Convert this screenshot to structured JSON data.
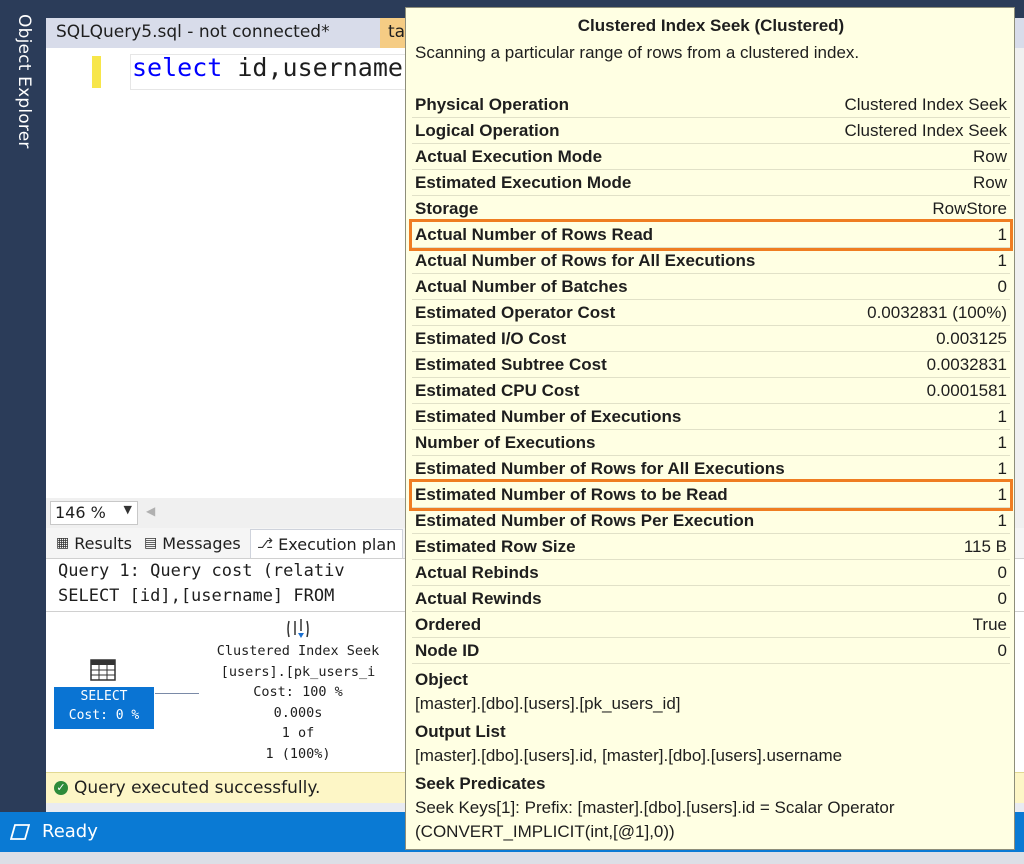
{
  "sidebar": {
    "object_explorer_label": "Object Explorer"
  },
  "tabs": {
    "active_tab": "SQLQuery5.sql - not connected*",
    "second_tab": "tal"
  },
  "editor": {
    "keyword": "select",
    "code_rest": " id,username"
  },
  "zoom": {
    "value": "146 %"
  },
  "result_tabs": {
    "results": "Results",
    "messages": "Messages",
    "execution_plan": "Execution plan"
  },
  "plan": {
    "query_cost_line": "Query 1: Query cost (relativ",
    "query_sql_line": "SELECT [id],[username] FROM",
    "select_node": {
      "label": "SELECT",
      "cost": "Cost: 0 %"
    },
    "seek_node": {
      "name": "Clustered Index Seek",
      "object": "[users].[pk_users_i",
      "cost": "Cost: 100 %",
      "time": "0.000s",
      "rows": "1 of",
      "percent": "1 (100%)"
    }
  },
  "status": {
    "query_message": "Query executed successfully.",
    "app_status": "Ready"
  },
  "tooltip": {
    "title": "Clustered Index Seek (Clustered)",
    "description": "Scanning a particular range of rows from a clustered index.",
    "properties": [
      {
        "name": "Physical Operation",
        "value": "Clustered Index Seek",
        "highlighted": false
      },
      {
        "name": "Logical Operation",
        "value": "Clustered Index Seek",
        "highlighted": false
      },
      {
        "name": "Actual Execution Mode",
        "value": "Row",
        "highlighted": false
      },
      {
        "name": "Estimated Execution Mode",
        "value": "Row",
        "highlighted": false
      },
      {
        "name": "Storage",
        "value": "RowStore",
        "highlighted": false
      },
      {
        "name": "Actual Number of Rows Read",
        "value": "1",
        "highlighted": true
      },
      {
        "name": "Actual Number of Rows for All Executions",
        "value": "1",
        "highlighted": false
      },
      {
        "name": "Actual Number of Batches",
        "value": "0",
        "highlighted": false
      },
      {
        "name": "Estimated Operator Cost",
        "value": "0.0032831 (100%)",
        "highlighted": false
      },
      {
        "name": "Estimated I/O Cost",
        "value": "0.003125",
        "highlighted": false
      },
      {
        "name": "Estimated Subtree Cost",
        "value": "0.0032831",
        "highlighted": false
      },
      {
        "name": "Estimated CPU Cost",
        "value": "0.0001581",
        "highlighted": false
      },
      {
        "name": "Estimated Number of Executions",
        "value": "1",
        "highlighted": false
      },
      {
        "name": "Number of Executions",
        "value": "1",
        "highlighted": false
      },
      {
        "name": "Estimated Number of Rows for All Executions",
        "value": "1",
        "highlighted": false
      },
      {
        "name": "Estimated Number of Rows to be Read",
        "value": "1",
        "highlighted": true
      },
      {
        "name": "Estimated Number of Rows Per Execution",
        "value": "1",
        "highlighted": false
      },
      {
        "name": "Estimated Row Size",
        "value": "115 B",
        "highlighted": false
      },
      {
        "name": "Actual Rebinds",
        "value": "0",
        "highlighted": false
      },
      {
        "name": "Actual Rewinds",
        "value": "0",
        "highlighted": false
      },
      {
        "name": "Ordered",
        "value": "True",
        "highlighted": false
      },
      {
        "name": "Node ID",
        "value": "0",
        "highlighted": false
      }
    ],
    "sections": {
      "object_title": "Object",
      "object_value": "[master].[dbo].[users].[pk_users_id]",
      "output_title": "Output List",
      "output_value": "[master].[dbo].[users].id, [master].[dbo].[users].username",
      "predicates_title": "Seek Predicates",
      "predicates_value": "Seek Keys[1]: Prefix: [master].[dbo].[users].id = Scalar Operator (CONVERT_IMPLICIT(int,[@1],0))"
    }
  },
  "colors": {
    "tooltip_bg": "#ffffe3",
    "highlight": "#ef7d22",
    "status_bar": "#0a7ad4",
    "sidebar": "#2b3c59"
  }
}
